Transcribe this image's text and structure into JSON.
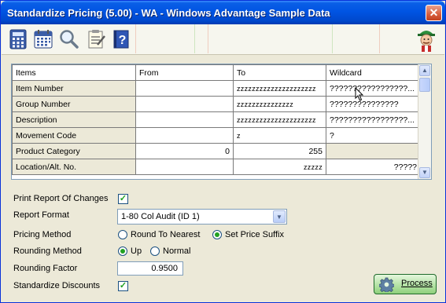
{
  "window": {
    "title": "Standardize Pricing (5.00) - WA - Windows Advantage Sample Data",
    "close_glyph": "✕"
  },
  "toolbar": {
    "icons": [
      "calculator-icon",
      "calendar-icon",
      "magnifier-icon",
      "checklist-icon",
      "help-book-icon"
    ],
    "help_glyph": "?"
  },
  "grid": {
    "columns": [
      "Items",
      "From",
      "To",
      "Wildcard"
    ],
    "rows": [
      {
        "item": "Item Number",
        "from": "",
        "to": "zzzzzzzzzzzzzzzzzzzzz",
        "wildcard": "?????????????????..."
      },
      {
        "item": "Group Number",
        "from": "",
        "to": "zzzzzzzzzzzzzzz",
        "wildcard": "???????????????"
      },
      {
        "item": "Description",
        "from": "",
        "to": "zzzzzzzzzzzzzzzzzzzzz",
        "wildcard": "?????????????????..."
      },
      {
        "item": "Movement Code",
        "from": "",
        "to": "z",
        "wildcard": "?"
      },
      {
        "item": "Product Category",
        "from": "0",
        "to": "255",
        "wildcard": ""
      },
      {
        "item": "Location/Alt. No.",
        "from": "",
        "to": "zzzzz",
        "wildcard": "?????"
      }
    ],
    "scroll_up": "▲",
    "scroll_down": "▼"
  },
  "form": {
    "print_report": {
      "label": "Print Report Of Changes",
      "checked": true,
      "glyph": "✓"
    },
    "report_format": {
      "label": "Report Format",
      "value": "1-80 Col Audit (ID 1)",
      "arrow": "▼"
    },
    "pricing_method": {
      "label": "Pricing Method",
      "options": [
        "Round To Nearest",
        "Set Price Suffix"
      ],
      "selected": "Set Price Suffix"
    },
    "rounding_method": {
      "label": "Rounding Method",
      "options": [
        "Up",
        "Normal"
      ],
      "selected": "Up"
    },
    "rounding_factor": {
      "label": "Rounding Factor",
      "value": "0.9500"
    },
    "standardize_discounts": {
      "label": "Standardize Discounts",
      "checked": true,
      "glyph": "✓"
    }
  },
  "process_button": {
    "label": "Process"
  }
}
